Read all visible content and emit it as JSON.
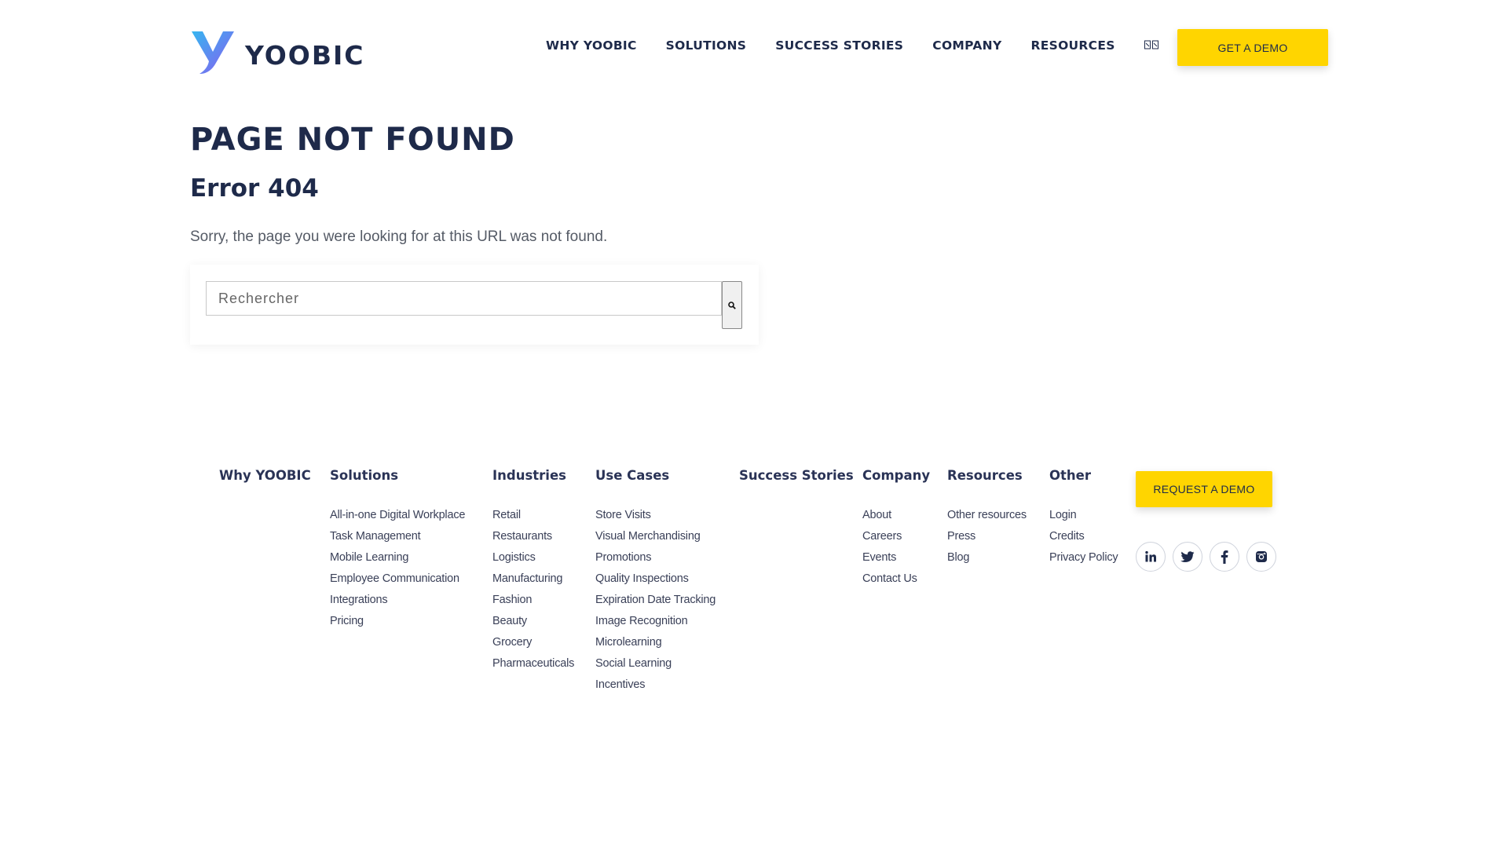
{
  "brand": {
    "name": "YOOBIC",
    "accent": "#ffd500",
    "navy": "#1e2a4a"
  },
  "nav": {
    "items": [
      "WHY YOOBIC",
      "SOLUTIONS",
      "SUCCESS STORIES",
      "COMPANY",
      "RESOURCES"
    ],
    "lang_icon": "language-icon",
    "demo_label": "GET A DEMO"
  },
  "main": {
    "title": "PAGE NOT FOUND",
    "subtitle": "Error 404",
    "message": "Sorry, the page you were looking for at this URL was not found.",
    "search": {
      "placeholder": "Rechercher",
      "icon": "search-icon"
    }
  },
  "footer": {
    "columns": [
      {
        "heading": "Why YOOBIC",
        "links": []
      },
      {
        "heading": "Solutions",
        "links": [
          "All-in-one Digital Workplace",
          "Task Management",
          "Mobile Learning",
          "Employee Communication",
          "Integrations",
          "Pricing"
        ]
      },
      {
        "heading": "Industries",
        "links": [
          "Retail",
          "Restaurants",
          "Logistics",
          "Manufacturing",
          "Fashion",
          "Beauty",
          "Grocery",
          "Pharmaceuticals"
        ]
      },
      {
        "heading": "Use Cases",
        "links": [
          "Store Visits",
          "Visual Merchandising",
          "Promotions",
          "Quality Inspections",
          "Expiration Date Tracking",
          "Image Recognition",
          "Microlearning",
          "Social Learning",
          "Incentives"
        ]
      },
      {
        "heading": "Success Stories",
        "links": []
      },
      {
        "heading": "Company",
        "links": [
          "About",
          "Careers",
          "Events",
          "Contact Us"
        ]
      },
      {
        "heading": "Resources",
        "links": [
          "Other resources",
          "Press",
          "Blog"
        ]
      },
      {
        "heading": "Other",
        "links": [
          "Login",
          "Credits",
          "Privacy Policy"
        ]
      }
    ],
    "request_demo_label": "REQUEST A DEMO",
    "socials": [
      "linkedin-icon",
      "twitter-icon",
      "facebook-icon",
      "instagram-icon"
    ]
  }
}
